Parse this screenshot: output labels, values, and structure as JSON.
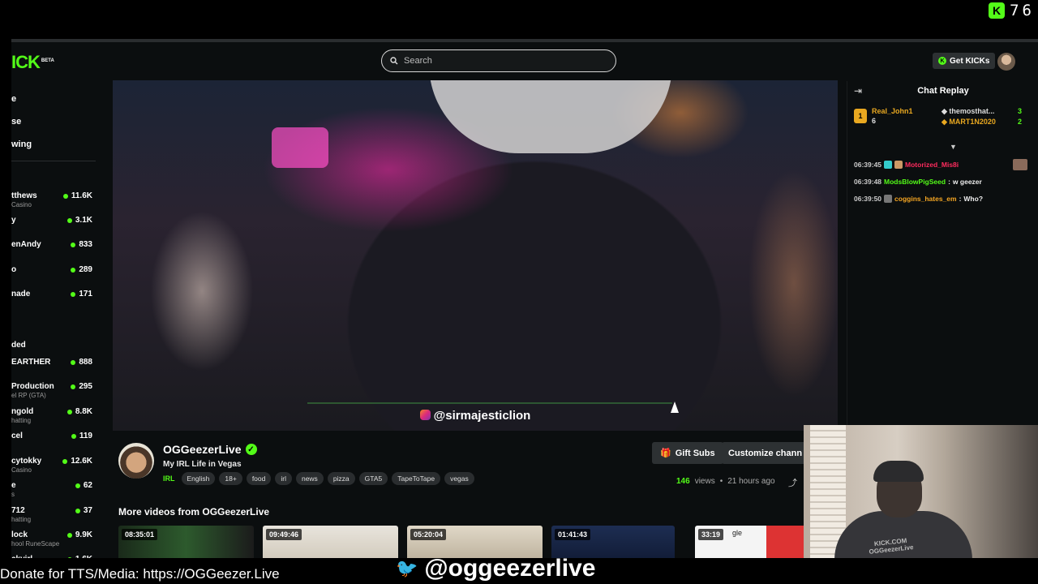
{
  "overlay": {
    "counter": "76",
    "donate_text": "Donate for TTS/Media: https://OGGeezer.Live",
    "twitter_handle": "@oggeezerlive",
    "video_handle": "@sirmajesticlion"
  },
  "header": {
    "logo": "ICK",
    "logo_badge": "BETA",
    "search_placeholder": "Search",
    "get_kicks_label": "Get KICKs"
  },
  "sidebar": {
    "nav": [
      "e",
      "se",
      "wing"
    ],
    "recommended": [
      {
        "name": "tthews",
        "sub": "Casino",
        "viewers": "11.6K"
      },
      {
        "name": "y",
        "sub": "",
        "viewers": "3.1K"
      },
      {
        "name": "enAndy",
        "sub": "",
        "viewers": "833"
      },
      {
        "name": "o",
        "sub": "",
        "viewers": "289"
      },
      {
        "name": "nade",
        "sub": "",
        "viewers": "171"
      }
    ],
    "section2_label": "ded",
    "followed": [
      {
        "name": "EARTHER",
        "sub": "",
        "viewers": "888"
      },
      {
        "name": "Production",
        "sub": "el RP (GTA)",
        "viewers": "295"
      },
      {
        "name": "ngold",
        "sub": "hatting",
        "viewers": "8.8K"
      },
      {
        "name": "cel",
        "sub": "",
        "viewers": "119"
      },
      {
        "name": "cytokky",
        "sub": "Casino",
        "viewers": "12.6K"
      },
      {
        "name": "e",
        "sub": "s",
        "viewers": "62"
      },
      {
        "name": "712",
        "sub": "hatting",
        "viewers": "37"
      },
      {
        "name": "lock",
        "sub": "hool RuneScape",
        "viewers": "9.9K"
      },
      {
        "name": "ckvirl",
        "sub": "",
        "viewers": "1.6K"
      }
    ]
  },
  "channel": {
    "name": "OGGeezerLive",
    "title": "My IRL Life in Vegas",
    "category": "IRL",
    "tags": [
      "English",
      "18+",
      "food",
      "irl",
      "news",
      "pizza",
      "GTA5",
      "TapeToTape",
      "vegas"
    ],
    "gift_subs_label": "Gift Subs",
    "customize_label": "Customize chann",
    "views_count": "146",
    "views_label": "views",
    "time_ago": "21 hours ago"
  },
  "more_videos": {
    "heading": "More videos from OGGeezerLive",
    "items": [
      {
        "duration": "08:35:01"
      },
      {
        "duration": "09:49:46"
      },
      {
        "duration": "05:20:04"
      },
      {
        "duration": "01:41:43"
      },
      {
        "duration": "33:19"
      }
    ],
    "partial_text": "gle"
  },
  "chat": {
    "title": "Chat Replay",
    "leaderboard": {
      "first_name": "Real_John1",
      "first_count": "6",
      "entries": [
        {
          "name": "themosthat...",
          "count": "3"
        },
        {
          "name": "MART1N2020",
          "count": "2"
        }
      ]
    },
    "messages": [
      {
        "time": "06:39:45",
        "user": "Motorized_Mis8i",
        "text": "",
        "color": "#ff2b5e"
      },
      {
        "time": "06:39:48",
        "user": "ModsBlowPigSeed",
        "text": "w geezer",
        "color": "#53fc18"
      },
      {
        "time": "06:39:50",
        "user": "coggins_hates_em",
        "text": "Who?",
        "color": "#f5a623"
      }
    ]
  },
  "webcam": {
    "shirt_text_1": "KICK.COM",
    "shirt_text_2": "OGGeezerLive"
  },
  "colors": {
    "accent": "#53fc18",
    "background": "#0b0e0f",
    "gold": "#e9a820"
  }
}
